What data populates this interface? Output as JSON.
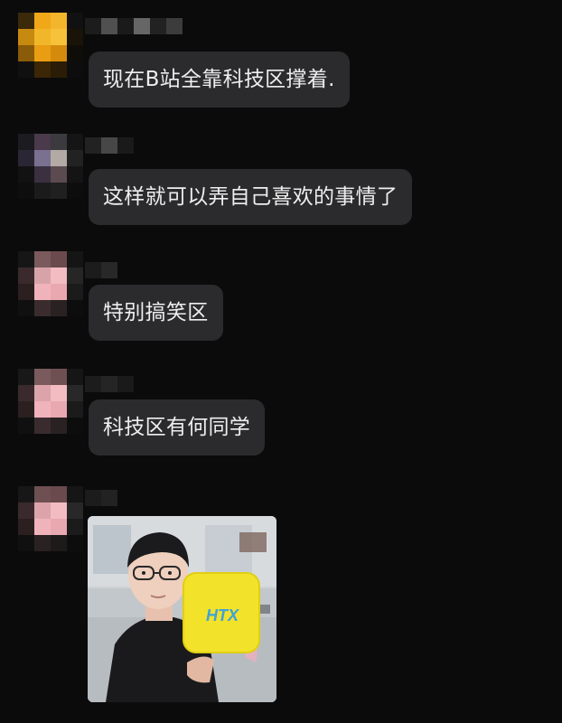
{
  "chat": {
    "messages": [
      {
        "text": "现在B站全靠科技区撑着."
      },
      {
        "text": "这样就可以弄自己喜欢的事情了"
      },
      {
        "text": "特别搞笑区"
      },
      {
        "text": "科技区有何同学"
      }
    ],
    "image_message": {
      "cube_text": "HTX"
    }
  },
  "colors": {
    "background": "#0b0b0c",
    "bubble": "#2b2b2d",
    "bubble_text": "#eeeeee",
    "cube_yellow": "#f2e22a",
    "cube_text_blue": "#3fa2d8"
  }
}
